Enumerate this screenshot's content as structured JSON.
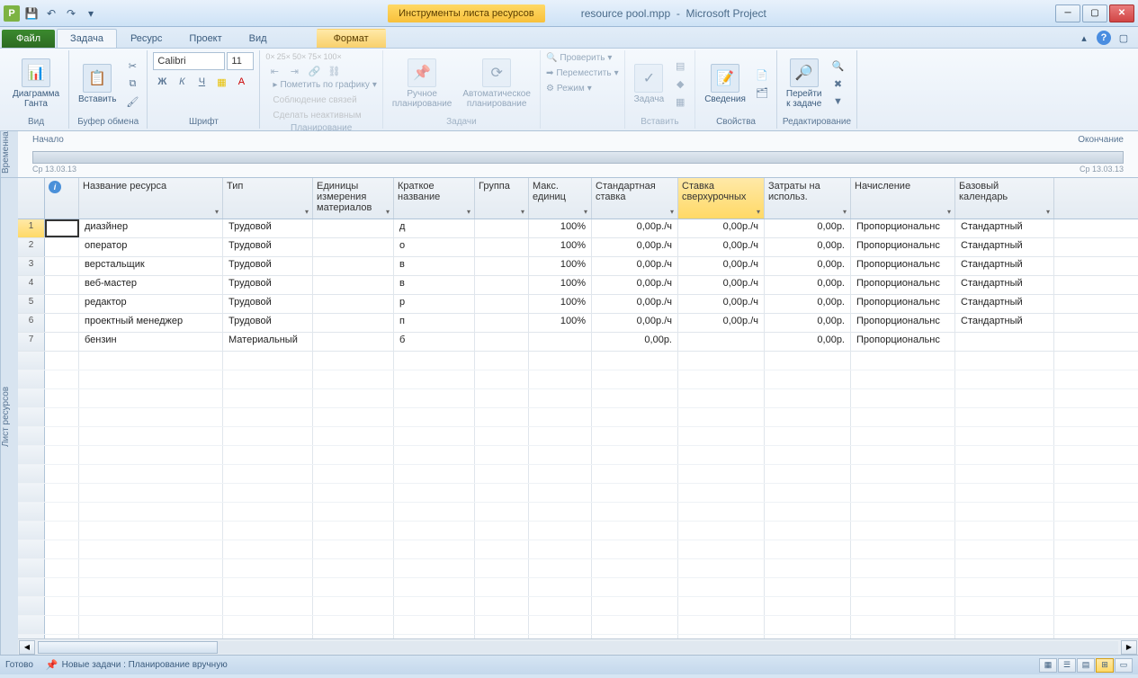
{
  "title": {
    "file": "resource pool.mpp",
    "app": "Microsoft Project",
    "context_tab": "Инструменты листа ресурсов"
  },
  "tabs": {
    "file": "Файл",
    "task": "Задача",
    "resource": "Ресурс",
    "project": "Проект",
    "view": "Вид",
    "format": "Формат"
  },
  "ribbon": {
    "gantt": "Диаграмма\nГанта",
    "gantt_grp": "Вид",
    "paste": "Вставить",
    "clipboard_grp": "Буфер обмена",
    "font_name": "Calibri",
    "font_size": "11",
    "font_grp": "Шрифт",
    "plan_mark": "Пометить по графику",
    "plan_links": "Соблюдение связей",
    "plan_inactive": "Сделать неактивным",
    "plan_grp": "Планирование",
    "manual": "Ручное\nпланирование",
    "auto": "Автоматическое\nпланирование",
    "tasks_grp": "Задачи",
    "check": "Проверить",
    "move": "Переместить",
    "mode": "Режим",
    "task_btn": "Задача",
    "insert_grp": "Вставить",
    "info": "Сведения",
    "props_grp": "Свойства",
    "scrollto": "Перейти\nк задаче",
    "edit_grp": "Редактирование"
  },
  "timeline": {
    "side": "Временна",
    "start": "Начало",
    "end": "Окончание",
    "start_date": "Ср 13.03.13",
    "end_date": "Ср 13.03.13"
  },
  "sheet_side": "Лист ресурсов",
  "columns": {
    "info": "ⓘ",
    "name": "Название ресурса",
    "type": "Тип",
    "units_label": "Единицы\nизмерения\nматериалов",
    "short": "Краткое\nназвание",
    "group": "Группа",
    "max": "Макс.\nединиц",
    "std_rate": "Стандартная\nставка",
    "ovt_rate": "Ставка\nсверхурочных",
    "cost_use": "Затраты на\nиспольз.",
    "accrue": "Начисление",
    "calendar": "Базовый\nкалендарь"
  },
  "rows": [
    {
      "n": 1,
      "name": "диазйнер",
      "type": "Трудовой",
      "short": "д",
      "max": "100%",
      "std": "0,00р./ч",
      "ovt": "0,00р./ч",
      "cost": "0,00р.",
      "accrue": "Пропорциональнс",
      "cal": "Стандартный"
    },
    {
      "n": 2,
      "name": "оператор",
      "type": "Трудовой",
      "short": "о",
      "max": "100%",
      "std": "0,00р./ч",
      "ovt": "0,00р./ч",
      "cost": "0,00р.",
      "accrue": "Пропорциональнс",
      "cal": "Стандартный"
    },
    {
      "n": 3,
      "name": "верстальщик",
      "type": "Трудовой",
      "short": "в",
      "max": "100%",
      "std": "0,00р./ч",
      "ovt": "0,00р./ч",
      "cost": "0,00р.",
      "accrue": "Пропорциональнс",
      "cal": "Стандартный"
    },
    {
      "n": 4,
      "name": "веб-мастер",
      "type": "Трудовой",
      "short": "в",
      "max": "100%",
      "std": "0,00р./ч",
      "ovt": "0,00р./ч",
      "cost": "0,00р.",
      "accrue": "Пропорциональнс",
      "cal": "Стандартный"
    },
    {
      "n": 5,
      "name": "редактор",
      "type": "Трудовой",
      "short": "р",
      "max": "100%",
      "std": "0,00р./ч",
      "ovt": "0,00р./ч",
      "cost": "0,00р.",
      "accrue": "Пропорциональнс",
      "cal": "Стандартный"
    },
    {
      "n": 6,
      "name": "проектный менеджер",
      "type": "Трудовой",
      "short": "п",
      "max": "100%",
      "std": "0,00р./ч",
      "ovt": "0,00р./ч",
      "cost": "0,00р.",
      "accrue": "Пропорциональнс",
      "cal": "Стандартный"
    },
    {
      "n": 7,
      "name": "бензин",
      "type": "Материальный",
      "short": "б",
      "max": "",
      "std": "0,00р.",
      "ovt": "",
      "cost": "0,00р.",
      "accrue": "Пропорциональнс",
      "cal": ""
    }
  ],
  "status": {
    "ready": "Готово",
    "newtask": "Новые задачи : Планирование вручную"
  }
}
